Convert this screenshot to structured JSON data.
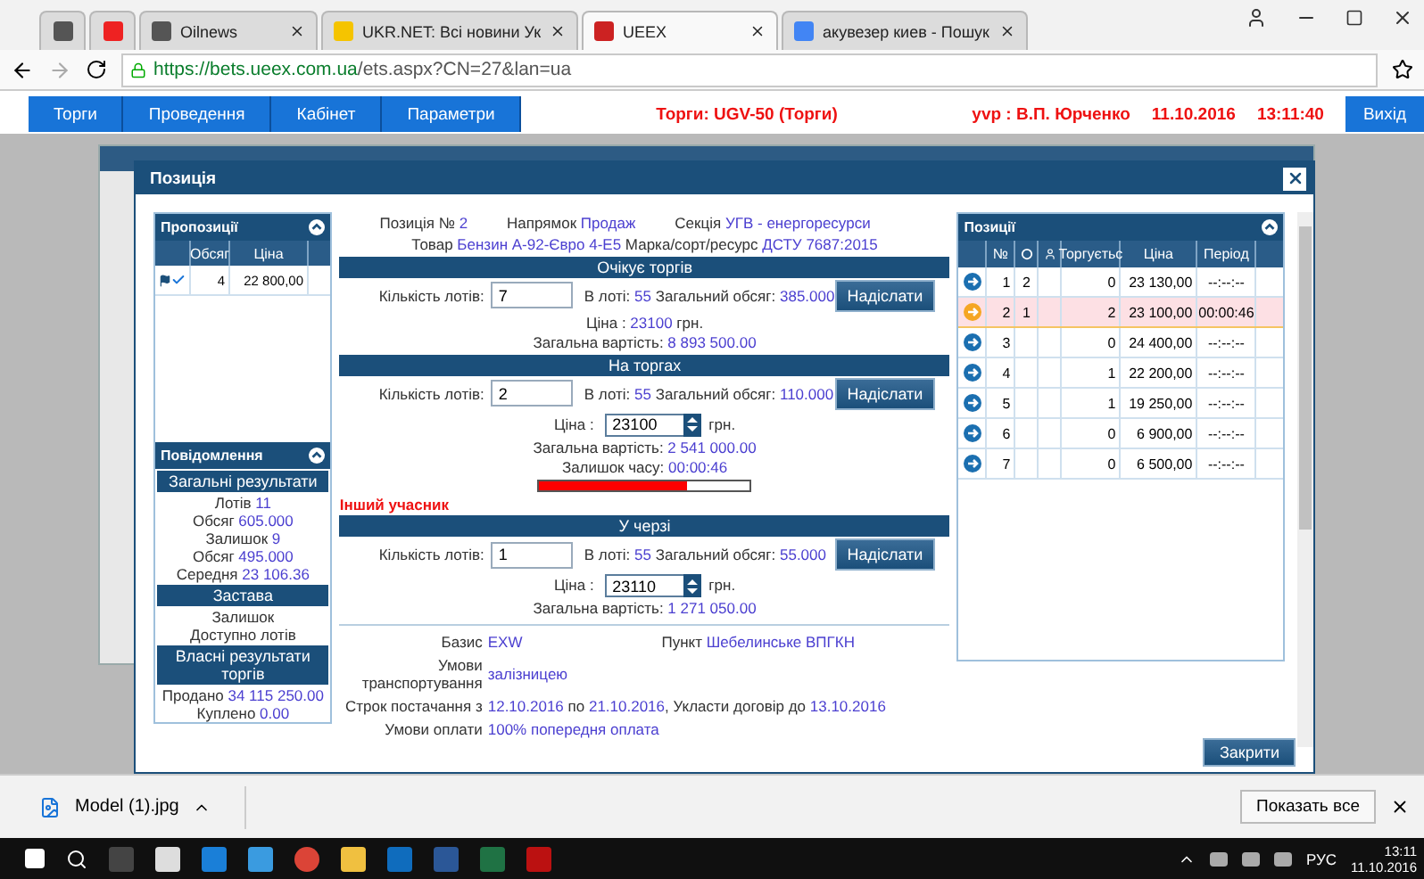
{
  "browser": {
    "tabs": [
      {
        "label": "Oilnews",
        "selected": false
      },
      {
        "label": "UKR.NET: Всі новини Ук",
        "selected": false
      },
      {
        "label": "UEEX",
        "selected": true
      },
      {
        "label": "акувезер киев - Пошук",
        "selected": false
      }
    ],
    "url_host": "https://bets.ueex.com.ua",
    "url_path": "/ets.aspx?CN=27&lan=ua"
  },
  "nav": {
    "items": [
      "Торги",
      "Проведення",
      "Кабінет",
      "Параметри"
    ],
    "status": "Торги: UGV-50 (Торги)",
    "user": "yvp : В.П. Юрченко",
    "date": "11.10.2016",
    "time": "13:11:40",
    "exit": "Вихід"
  },
  "modal": {
    "title": "Позиція",
    "close_button": "Закрити",
    "proposals": {
      "title": "Пропозиції",
      "columns": [
        "Обсяг",
        "Ціна"
      ],
      "rows": [
        {
          "volume": "4",
          "price": "22 800,00"
        }
      ]
    },
    "messages": {
      "title": "Повідомлення"
    },
    "result_blocks": [
      {
        "title": "Загальні результати",
        "lines": [
          [
            {
              "text": "Лотів ",
              "highlight": false
            },
            {
              "text": "11",
              "highlight": true
            }
          ],
          [
            {
              "text": "Обсяг ",
              "highlight": false
            },
            {
              "text": "605.000",
              "highlight": true
            }
          ],
          [
            {
              "text": "Залишок ",
              "highlight": false
            },
            {
              "text": "9",
              "highlight": true
            }
          ],
          [
            {
              "text": "Обсяг ",
              "highlight": false
            },
            {
              "text": "495.000",
              "highlight": true
            }
          ],
          [
            {
              "text": "Середня ",
              "highlight": false
            },
            {
              "text": "23 106.36",
              "highlight": true
            }
          ]
        ]
      },
      {
        "title": "Застава",
        "lines": [
          [
            {
              "text": "Залишок",
              "highlight": false
            }
          ],
          [
            {
              "text": "Доступно лотів",
              "highlight": false
            }
          ]
        ]
      },
      {
        "title": "Власні результати торгів",
        "lines": [
          [
            {
              "text": "Продано ",
              "highlight": false
            },
            {
              "text": "34 115 250.00",
              "highlight": true
            }
          ],
          [
            {
              "text": "Куплено ",
              "highlight": false
            },
            {
              "text": "0.00",
              "highlight": true
            }
          ]
        ]
      }
    ],
    "header_lines": [
      [
        {
          "text": "Позиція № ",
          "highlight": false
        },
        {
          "text": "2",
          "highlight": true
        },
        {
          "text": "Напрямок ",
          "highlight": false
        },
        {
          "text": "Продаж",
          "highlight": true
        },
        {
          "text": "Секція ",
          "highlight": false
        },
        {
          "text": "УГВ - енергоресурси",
          "highlight": true
        }
      ],
      [
        {
          "text": "Товар ",
          "highlight": false
        },
        {
          "text": "Бензин А-92-Євро 4-Е5",
          "highlight": true
        },
        {
          "text": " Марка/сорт/ресурс ",
          "highlight": false
        },
        {
          "text": "ДСТУ 7687:2015",
          "highlight": true
        }
      ]
    ],
    "sections": [
      {
        "title": "Очікує торгів",
        "lots_label": "Кількість лотів:",
        "lots": "7",
        "info": [
          {
            "text": "В лоті: ",
            "highlight": false
          },
          {
            "text": "55",
            "highlight": true
          },
          {
            "text": " Загальний обсяг: ",
            "highlight": false
          },
          {
            "text": "385.000",
            "highlight": true
          }
        ],
        "button": "Надіслати",
        "price": {
          "kind": "text",
          "label": "Ціна : ",
          "value": "23100",
          "unit": " грн."
        },
        "total": [
          {
            "text": "Загальна вартість: ",
            "highlight": false
          },
          {
            "text": "8 893 500.00",
            "highlight": true
          }
        ]
      },
      {
        "title": "На торгах",
        "lots_label": "Кількість лотів:",
        "lots": "2",
        "info": [
          {
            "text": "В лоті: ",
            "highlight": false
          },
          {
            "text": "55",
            "highlight": true
          },
          {
            "text": " Загальний обсяг: ",
            "highlight": false
          },
          {
            "text": "110.000",
            "highlight": true
          }
        ],
        "button": "Надіслати",
        "price": {
          "kind": "spinner",
          "label": "Ціна : ",
          "value": "23100",
          "unit": "грн."
        },
        "total": [
          {
            "text": "Загальна вартість: ",
            "highlight": false
          },
          {
            "text": "2 541 000.00",
            "highlight": true
          }
        ],
        "timer": {
          "label": "Залишок часу: ",
          "value": "00:00:46",
          "level": 0.7
        },
        "note": "Інший учасник"
      },
      {
        "title": "У черзі",
        "lots_label": "Кількість лотів:",
        "lots": "1",
        "info": [
          {
            "text": "В лоті: ",
            "highlight": false
          },
          {
            "text": "55",
            "highlight": true
          },
          {
            "text": " Загальний обсяг: ",
            "highlight": false
          },
          {
            "text": "55.000",
            "highlight": true
          }
        ],
        "button": "Надіслати",
        "price": {
          "kind": "spinner",
          "label": "Ціна : ",
          "value": "23110",
          "unit": "грн."
        },
        "total": [
          {
            "text": "Загальна вартість: ",
            "highlight": false
          },
          {
            "text": "1 271 050.00",
            "highlight": true
          }
        ]
      }
    ],
    "details": [
      {
        "label": "Базис",
        "value": [
          {
            "text": "EXW",
            "highlight": true
          }
        ],
        "label2": "Пункт",
        "value2": "Шебелинське ВПГКН"
      },
      {
        "label": "Умови транспортування",
        "value": [
          {
            "text": "залізницею",
            "highlight": true
          }
        ]
      },
      {
        "label": "Строк постачання з",
        "value": [
          {
            "text": "12.10.2016",
            "highlight": true
          },
          {
            "text": " по ",
            "highlight": false
          },
          {
            "text": "21.10.2016",
            "highlight": true
          },
          {
            "text": ", Укласти договір до ",
            "highlight": false
          },
          {
            "text": "13.10.2016",
            "highlight": true
          }
        ]
      },
      {
        "label": "Умови оплати",
        "value": [
          {
            "text": "100% попередня оплата",
            "highlight": true
          }
        ]
      }
    ],
    "positions": {
      "title": "Позиції",
      "columns": [
        "№",
        "Торгуєтьс",
        "Ціна",
        "Період"
      ],
      "rows": [
        {
          "num": "1",
          "offers": "2",
          "trading": "0",
          "price": "23 130,00",
          "period": "--:--:--",
          "selected": false
        },
        {
          "num": "2",
          "offers": "1",
          "trading": "2",
          "price": "23 100,00",
          "period": "00:00:46",
          "selected": true
        },
        {
          "num": "3",
          "offers": "",
          "trading": "0",
          "price": "24 400,00",
          "period": "--:--:--",
          "selected": false
        },
        {
          "num": "4",
          "offers": "",
          "trading": "1",
          "price": "22 200,00",
          "period": "--:--:--",
          "selected": false
        },
        {
          "num": "5",
          "offers": "",
          "trading": "1",
          "price": "19 250,00",
          "period": "--:--:--",
          "selected": false
        },
        {
          "num": "6",
          "offers": "",
          "trading": "0",
          "price": "6 900,00",
          "period": "--:--:--",
          "selected": false
        },
        {
          "num": "7",
          "offers": "",
          "trading": "0",
          "price": "6 500,00",
          "period": "--:--:--",
          "selected": false
        }
      ]
    }
  },
  "downloads": {
    "file": "Model (1).jpg",
    "show_all": "Показать все"
  },
  "taskbar": {
    "lang": "РУС",
    "time": "13:11",
    "date": "11.10.2016"
  }
}
